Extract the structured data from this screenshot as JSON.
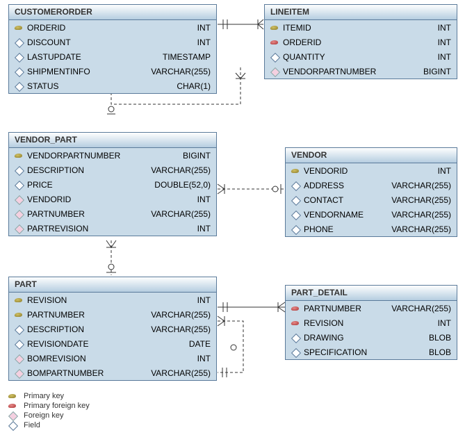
{
  "legend": {
    "pk": "Primary key",
    "pfk": "Primary foreign key",
    "fk": "Foreign key",
    "field": "Field"
  },
  "entities": {
    "customerorder": {
      "title": "CUSTOMERORDER",
      "fields": [
        {
          "icon": "pk",
          "name": "ORDERID",
          "type": "INT"
        },
        {
          "icon": "field",
          "name": "DISCOUNT",
          "type": "INT"
        },
        {
          "icon": "field",
          "name": "LASTUPDATE",
          "type": "TIMESTAMP"
        },
        {
          "icon": "field",
          "name": "SHIPMENTINFO",
          "type": "VARCHAR(255)"
        },
        {
          "icon": "field",
          "name": "STATUS",
          "type": "CHAR(1)"
        }
      ]
    },
    "lineitem": {
      "title": "LINEITEM",
      "fields": [
        {
          "icon": "pk",
          "name": "ITEMID",
          "type": "INT"
        },
        {
          "icon": "pfk",
          "name": "ORDERID",
          "type": "INT"
        },
        {
          "icon": "field",
          "name": "QUANTITY",
          "type": "INT"
        },
        {
          "icon": "fk",
          "name": "VENDORPARTNUMBER",
          "type": "BIGINT"
        }
      ]
    },
    "vendor_part": {
      "title": "VENDOR_PART",
      "fields": [
        {
          "icon": "pk",
          "name": "VENDORPARTNUMBER",
          "type": "BIGINT"
        },
        {
          "icon": "field",
          "name": "DESCRIPTION",
          "type": "VARCHAR(255)"
        },
        {
          "icon": "field",
          "name": "PRICE",
          "type": "DOUBLE(52,0)"
        },
        {
          "icon": "fk",
          "name": "VENDORID",
          "type": "INT"
        },
        {
          "icon": "fk",
          "name": "PARTNUMBER",
          "type": "VARCHAR(255)"
        },
        {
          "icon": "fk",
          "name": "PARTREVISION",
          "type": "INT"
        }
      ]
    },
    "vendor": {
      "title": "VENDOR",
      "fields": [
        {
          "icon": "pk",
          "name": "VENDORID",
          "type": "INT"
        },
        {
          "icon": "field",
          "name": "ADDRESS",
          "type": "VARCHAR(255)"
        },
        {
          "icon": "field",
          "name": "CONTACT",
          "type": "VARCHAR(255)"
        },
        {
          "icon": "field",
          "name": "VENDORNAME",
          "type": "VARCHAR(255)"
        },
        {
          "icon": "field",
          "name": "PHONE",
          "type": "VARCHAR(255)"
        }
      ]
    },
    "part": {
      "title": "PART",
      "fields": [
        {
          "icon": "pk",
          "name": "REVISION",
          "type": "INT"
        },
        {
          "icon": "pk",
          "name": "PARTNUMBER",
          "type": "VARCHAR(255)"
        },
        {
          "icon": "field",
          "name": "DESCRIPTION",
          "type": "VARCHAR(255)"
        },
        {
          "icon": "field",
          "name": "REVISIONDATE",
          "type": "DATE"
        },
        {
          "icon": "fk",
          "name": "BOMREVISION",
          "type": "INT"
        },
        {
          "icon": "fk",
          "name": "BOMPARTNUMBER",
          "type": "VARCHAR(255)"
        }
      ]
    },
    "part_detail": {
      "title": "PART_DETAIL",
      "fields": [
        {
          "icon": "pfk",
          "name": "PARTNUMBER",
          "type": "VARCHAR(255)"
        },
        {
          "icon": "pfk",
          "name": "REVISION",
          "type": "INT"
        },
        {
          "icon": "field",
          "name": "DRAWING",
          "type": "BLOB"
        },
        {
          "icon": "field",
          "name": "SPECIFICATION",
          "type": "BLOB"
        }
      ]
    }
  },
  "chart_data": {
    "type": "table",
    "description": "Entity-relationship diagram for an order/parts schema",
    "entities": [
      {
        "name": "CUSTOMERORDER",
        "columns": [
          [
            "ORDERID",
            "INT",
            "PK"
          ],
          [
            "DISCOUNT",
            "INT",
            ""
          ],
          [
            "LASTUPDATE",
            "TIMESTAMP",
            ""
          ],
          [
            "SHIPMENTINFO",
            "VARCHAR(255)",
            ""
          ],
          [
            "STATUS",
            "CHAR(1)",
            ""
          ]
        ]
      },
      {
        "name": "LINEITEM",
        "columns": [
          [
            "ITEMID",
            "INT",
            "PK"
          ],
          [
            "ORDERID",
            "INT",
            "PFK"
          ],
          [
            "QUANTITY",
            "INT",
            ""
          ],
          [
            "VENDORPARTNUMBER",
            "BIGINT",
            "FK"
          ]
        ]
      },
      {
        "name": "VENDOR_PART",
        "columns": [
          [
            "VENDORPARTNUMBER",
            "BIGINT",
            "PK"
          ],
          [
            "DESCRIPTION",
            "VARCHAR(255)",
            ""
          ],
          [
            "PRICE",
            "DOUBLE(52,0)",
            ""
          ],
          [
            "VENDORID",
            "INT",
            "FK"
          ],
          [
            "PARTNUMBER",
            "VARCHAR(255)",
            "FK"
          ],
          [
            "PARTREVISION",
            "INT",
            "FK"
          ]
        ]
      },
      {
        "name": "VENDOR",
        "columns": [
          [
            "VENDORID",
            "INT",
            "PK"
          ],
          [
            "ADDRESS",
            "VARCHAR(255)",
            ""
          ],
          [
            "CONTACT",
            "VARCHAR(255)",
            ""
          ],
          [
            "VENDORNAME",
            "VARCHAR(255)",
            ""
          ],
          [
            "PHONE",
            "VARCHAR(255)",
            ""
          ]
        ]
      },
      {
        "name": "PART",
        "columns": [
          [
            "REVISION",
            "INT",
            "PK"
          ],
          [
            "PARTNUMBER",
            "VARCHAR(255)",
            "PK"
          ],
          [
            "DESCRIPTION",
            "VARCHAR(255)",
            ""
          ],
          [
            "REVISIONDATE",
            "DATE",
            ""
          ],
          [
            "BOMREVISION",
            "INT",
            "FK"
          ],
          [
            "BOMPARTNUMBER",
            "VARCHAR(255)",
            "FK"
          ]
        ]
      },
      {
        "name": "PART_DETAIL",
        "columns": [
          [
            "PARTNUMBER",
            "VARCHAR(255)",
            "PFK"
          ],
          [
            "REVISION",
            "INT",
            "PFK"
          ],
          [
            "DRAWING",
            "BLOB",
            ""
          ],
          [
            "SPECIFICATION",
            "BLOB",
            ""
          ]
        ]
      }
    ],
    "relationships": [
      {
        "from": "CUSTOMERORDER",
        "to": "LINEITEM",
        "type": "one-to-many",
        "style": "solid"
      },
      {
        "from": "VENDOR_PART",
        "to": "LINEITEM",
        "type": "zero/one-to-many",
        "style": "dashed"
      },
      {
        "from": "VENDOR",
        "to": "VENDOR_PART",
        "type": "zero/one-to-many",
        "style": "dashed"
      },
      {
        "from": "PART",
        "to": "VENDOR_PART",
        "type": "zero/one-to-many",
        "style": "dashed"
      },
      {
        "from": "PART",
        "to": "PART_DETAIL",
        "type": "one-to-many",
        "style": "solid"
      },
      {
        "from": "PART",
        "to": "PART",
        "type": "zero/one-to-many (self)",
        "style": "dashed"
      }
    ]
  }
}
